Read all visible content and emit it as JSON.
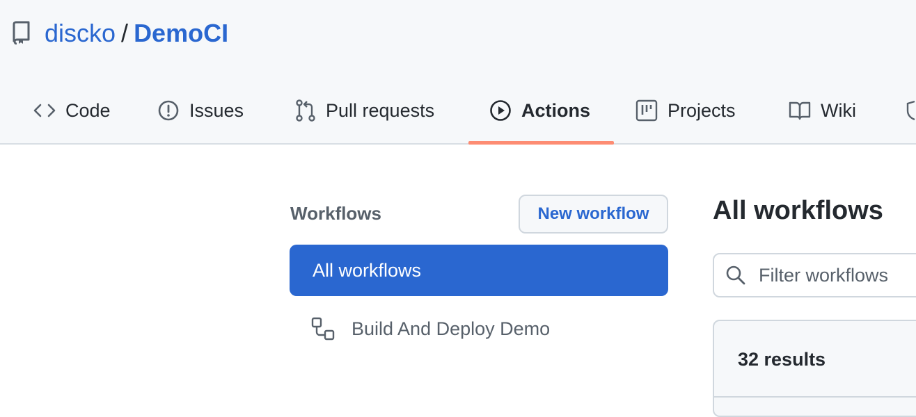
{
  "repo": {
    "owner": "discko",
    "separator": "/",
    "name": "DemoCI",
    "icon": "repo-icon"
  },
  "tabs": [
    {
      "label": "Code",
      "icon": "code-icon",
      "active": false
    },
    {
      "label": "Issues",
      "icon": "issue-opened-icon",
      "active": false
    },
    {
      "label": "Pull requests",
      "icon": "pull-request-icon",
      "active": false
    },
    {
      "label": "Actions",
      "icon": "play-icon",
      "active": true
    },
    {
      "label": "Projects",
      "icon": "project-icon",
      "active": false
    },
    {
      "label": "Wiki",
      "icon": "book-icon",
      "active": false
    },
    {
      "label": "",
      "icon": "shield-icon",
      "active": false
    }
  ],
  "sidebar": {
    "title": "Workflows",
    "new_button_label": "New workflow",
    "items": [
      {
        "label": "All workflows",
        "selected": true
      },
      {
        "label": "Build And Deploy Demo",
        "icon": "workflow-icon",
        "selected": false
      }
    ]
  },
  "main": {
    "title": "All workflows",
    "filter_placeholder": "Filter workflows",
    "filter_value": "",
    "results_label": "32 results"
  },
  "colors": {
    "accent": "#2a67d0",
    "tab_underline": "#fd8c73",
    "header_bg": "#f6f8fa"
  }
}
